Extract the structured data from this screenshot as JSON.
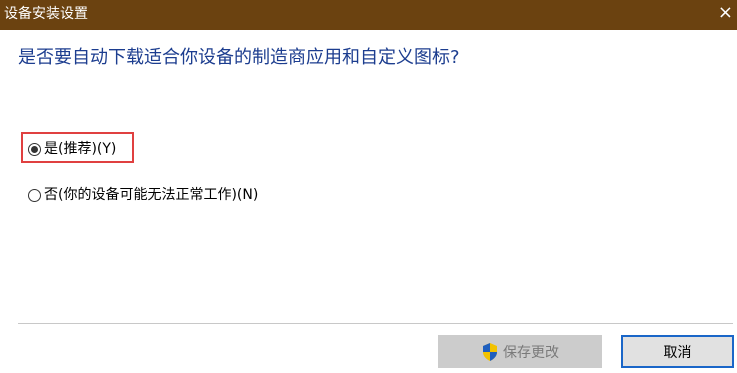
{
  "window": {
    "title": "设备安装设置",
    "close_glyph": "×"
  },
  "question": "是否要自动下载适合你设备的制造商应用和自定义图标?",
  "options": [
    {
      "label": "是(推荐)(Y)",
      "selected": true
    },
    {
      "label": "否(你的设备可能无法正常工作)(N)",
      "selected": false
    }
  ],
  "buttons": {
    "save_label": "保存更改",
    "save_icon": "uac-shield-icon",
    "save_enabled": false,
    "cancel_label": "取消"
  },
  "colors": {
    "titlebar": "#6b4210",
    "question_text": "#1c3d8f",
    "highlight_border": "#e04040",
    "focus_border": "#1a66c8"
  }
}
